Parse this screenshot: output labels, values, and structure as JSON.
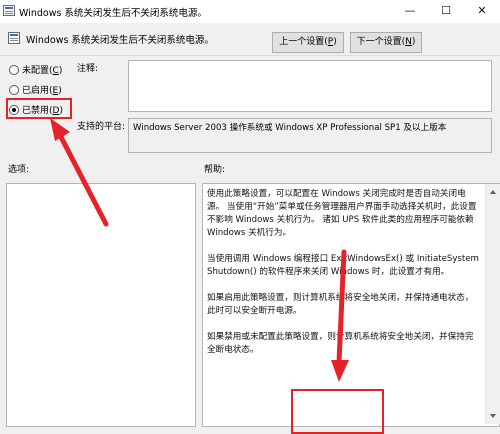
{
  "window": {
    "title": "Windows 系统关闭发生后不关闭系统电源。",
    "minimize": "—",
    "maximize": "☐",
    "close": "✕"
  },
  "header": {
    "policy_name": "Windows 系统关闭发生后不关闭系统电源。",
    "prev_label": "上一个设置",
    "prev_key": "P",
    "next_label": "下一个设置",
    "next_key": "N"
  },
  "options": {
    "not_configured": {
      "label": "未配置",
      "key": "C"
    },
    "enabled": {
      "label": "已启用",
      "key": "E"
    },
    "disabled": {
      "label": "已禁用",
      "key": "D"
    },
    "selected": "disabled"
  },
  "comment": {
    "label": "注释:",
    "value": ""
  },
  "platform": {
    "label": "支持的平台:",
    "value": "Windows Server 2003 操作系统或 Windows XP Professional SP1 及以上版本"
  },
  "sections": {
    "options_label": "选项:",
    "help_label": "帮助:"
  },
  "help_paragraphs": [
    "使用此策略设置，可以配置在 Windows 关闭完成时是否自动关闭电源。 当使用“开始”菜单或任务管理器用户界面手动选择关机时，此设置不影响 Windows 关机行为。 诸如 UPS 软件此类的应用程序可能依赖 Windows 关机行为。",
    "当使用调用 Windows 编程接口 ExitWindowsEx() 或 InitiateSystemShutdown() 的软件程序来关闭 Windows 时，此设置才有用。",
    "如果启用此策略设置，则计算机系统将安全地关闭，并保持通电状态，此时可以安全断开电源。",
    "如果禁用或未配置此策略设置，则计算机系统将安全地关闭，并保持完全断电状态。"
  ],
  "annotation_color": "#e5212a"
}
